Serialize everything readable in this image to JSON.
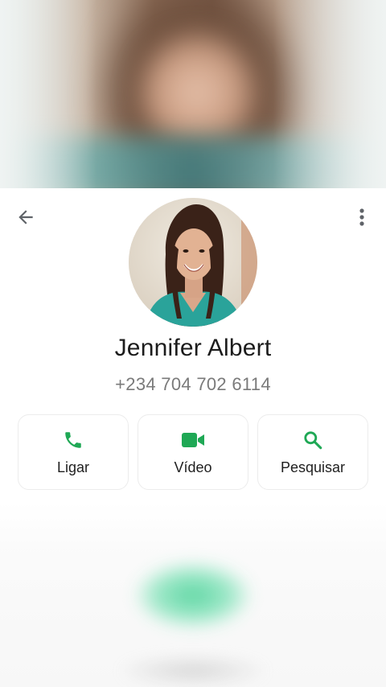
{
  "contact": {
    "name": "Jennifer Albert",
    "phone": "+234 704 702 6114"
  },
  "header": {
    "back_icon": "arrow-left-icon",
    "menu_icon": "more-vert-icon"
  },
  "actions": [
    {
      "label": "Ligar",
      "icon": "phone-icon"
    },
    {
      "label": "Vídeo",
      "icon": "video-camera-icon"
    },
    {
      "label": "Pesquisar",
      "icon": "search-icon"
    }
  ],
  "colors": {
    "accent": "#1fa855",
    "icon_gray": "#5f6368",
    "name_text": "#1c1c1c",
    "phone_text": "#7a7a7a"
  }
}
